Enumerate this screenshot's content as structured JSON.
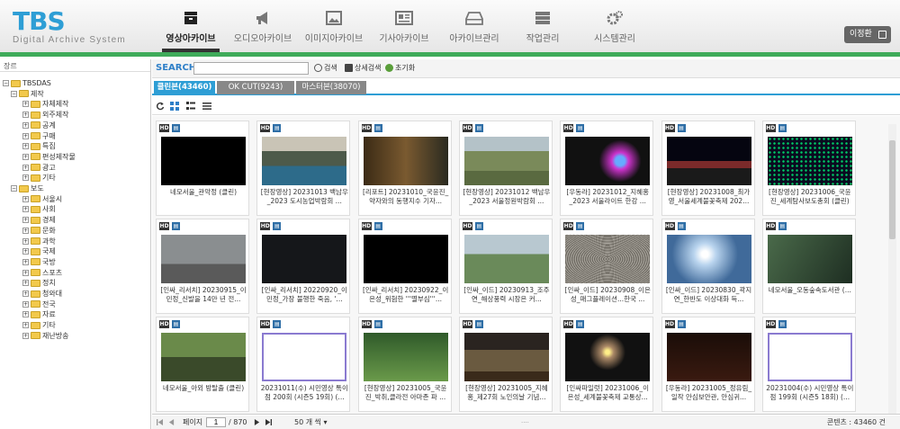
{
  "header": {
    "logo": "TBS",
    "logo_sub": "Digital Archive System",
    "user": "이정환",
    "nav": [
      {
        "label": "영상아카이브",
        "icon": "film-archive-icon"
      },
      {
        "label": "오디오아카이브",
        "icon": "megaphone-icon"
      },
      {
        "label": "이미지아카이브",
        "icon": "image-icon"
      },
      {
        "label": "기사아카이브",
        "icon": "news-icon"
      },
      {
        "label": "아카이브관리",
        "icon": "drive-icon"
      },
      {
        "label": "작업관리",
        "icon": "server-icon"
      },
      {
        "label": "시스템관리",
        "icon": "gear-icon"
      }
    ]
  },
  "sidebar": {
    "header": "장르",
    "tree": [
      {
        "label": "TBSDAS",
        "level": 0
      },
      {
        "label": "제작",
        "level": 1
      },
      {
        "label": "자체제작",
        "level": 2
      },
      {
        "label": "외주제작",
        "level": 2
      },
      {
        "label": "공계",
        "level": 2
      },
      {
        "label": "구매",
        "level": 2
      },
      {
        "label": "특집",
        "level": 2
      },
      {
        "label": "편성제작물",
        "level": 2
      },
      {
        "label": "광고",
        "level": 2
      },
      {
        "label": "기타",
        "level": 2
      },
      {
        "label": "보도",
        "level": 1
      },
      {
        "label": "서울시",
        "level": 2
      },
      {
        "label": "사회",
        "level": 2
      },
      {
        "label": "경제",
        "level": 2
      },
      {
        "label": "문화",
        "level": 2
      },
      {
        "label": "과학",
        "level": 2
      },
      {
        "label": "국제",
        "level": 2
      },
      {
        "label": "국방",
        "level": 2
      },
      {
        "label": "스포츠",
        "level": 2
      },
      {
        "label": "정치",
        "level": 2
      },
      {
        "label": "청와대",
        "level": 2
      },
      {
        "label": "전국",
        "level": 2
      },
      {
        "label": "자료",
        "level": 2
      },
      {
        "label": "기타",
        "level": 2
      },
      {
        "label": "재난방송",
        "level": 2
      }
    ]
  },
  "search": {
    "label": "SEARCH",
    "value": "",
    "search_btn": "검색",
    "detail_btn": "상세검색",
    "reset_btn": "초기화"
  },
  "tabs": [
    {
      "label": "클린본(43460)",
      "active": true
    },
    {
      "label": "OK CUT(9243)",
      "active": false
    },
    {
      "label": "마스터본(38070)",
      "active": false
    }
  ],
  "cards": [
    {
      "cap": "네모서울_관악정 (클린)",
      "hd": "HD",
      "thumb": "black"
    },
    {
      "cap": "[현장영상] 20231013 백남우_2023 도시농업박람회 ...",
      "hd": "HD",
      "thumb": "crowd"
    },
    {
      "cap": "[리포트] 20231010_국윤진_약자와의 동행지수 기자...",
      "hd": "HD",
      "thumb": "room"
    },
    {
      "cap": "[현장영상] 20231012 백남우_2023 서울정원박람회 ...",
      "hd": "HD",
      "thumb": "aerial"
    },
    {
      "cap": "[우동라] 20231012_지혜홍_2023 서울라이트 한강 ...",
      "hd": "HD",
      "thumb": "night-neon"
    },
    {
      "cap": "[현장영상] 20231008_최가영_서울세계불꽃축제 202...",
      "hd": "HD",
      "thumb": "night-stage"
    },
    {
      "cap": "[현장영상] 20231006_국윤진_세계탐사보도총회 (클린)",
      "hd": "HD",
      "thumb": "led"
    },
    {
      "cap": "[인싸_리서치] 20230915_이민정_신발을 14만 년 전...",
      "hd": "HD",
      "thumb": "rain"
    },
    {
      "cap": "[인싸_리서치] 20220920_이민정_가장 불행한 죽음, '...",
      "hd": "HD",
      "thumb": "dark"
    },
    {
      "cap": "[인싸_리서치] 20230922_이은성_위험한 '''멸부심'''...",
      "hd": "HD",
      "thumb": "black"
    },
    {
      "cap": "[인싸_이드] 20230913_조주연_해상풍력 시장은 커...",
      "hd": "HD",
      "thumb": "wind"
    },
    {
      "cap": "[인싸_이드] 20230908_이은성_매그플레이션...한국 ...",
      "hd": "HD",
      "thumb": "gravel"
    },
    {
      "cap": "[인싸_이드] 20230830_곽지연_한반도 이상대화 득...",
      "hd": "HD",
      "thumb": "sun"
    },
    {
      "cap": "네모서울_오동숲속도서관 (...",
      "hd": "HD",
      "thumb": "forest"
    },
    {
      "cap": "네모서울_아외 방탈출 (클린)",
      "hd": "HD",
      "thumb": "person"
    },
    {
      "cap": "20231011(수) 시민영상 톡이점 200회 (시즌5 19회) (...",
      "hd": "HD",
      "thumb": "doc"
    },
    {
      "cap": "[현장영상] 20231005_국윤진_박취,클라전 아마존 파 ...",
      "hd": "HD",
      "thumb": "green"
    },
    {
      "cap": "[현장영상] 20231005_지혜홍_제27회 노인의날 기념...",
      "hd": "HD",
      "thumb": "hall"
    },
    {
      "cap": "[인싸파일럿] 20231006_이은성_세계불꽃축제 교통상...",
      "hd": "HD",
      "thumb": "fireworks"
    },
    {
      "cap": "[우동라] 20231005_정유림_일작 안심보안관, 안심귀...",
      "hd": "HD",
      "thumb": "dark-red"
    },
    {
      "cap": "20231004(수) 시민영상 톡이점 199회 (시즌5 18회) (...",
      "hd": "HD",
      "thumb": "doc"
    }
  ],
  "pager": {
    "page_label": "페이지",
    "page": "1",
    "total": "/ 870",
    "per_page": "50 개 씩",
    "count": "콘텐츠 : 43460 건"
  }
}
